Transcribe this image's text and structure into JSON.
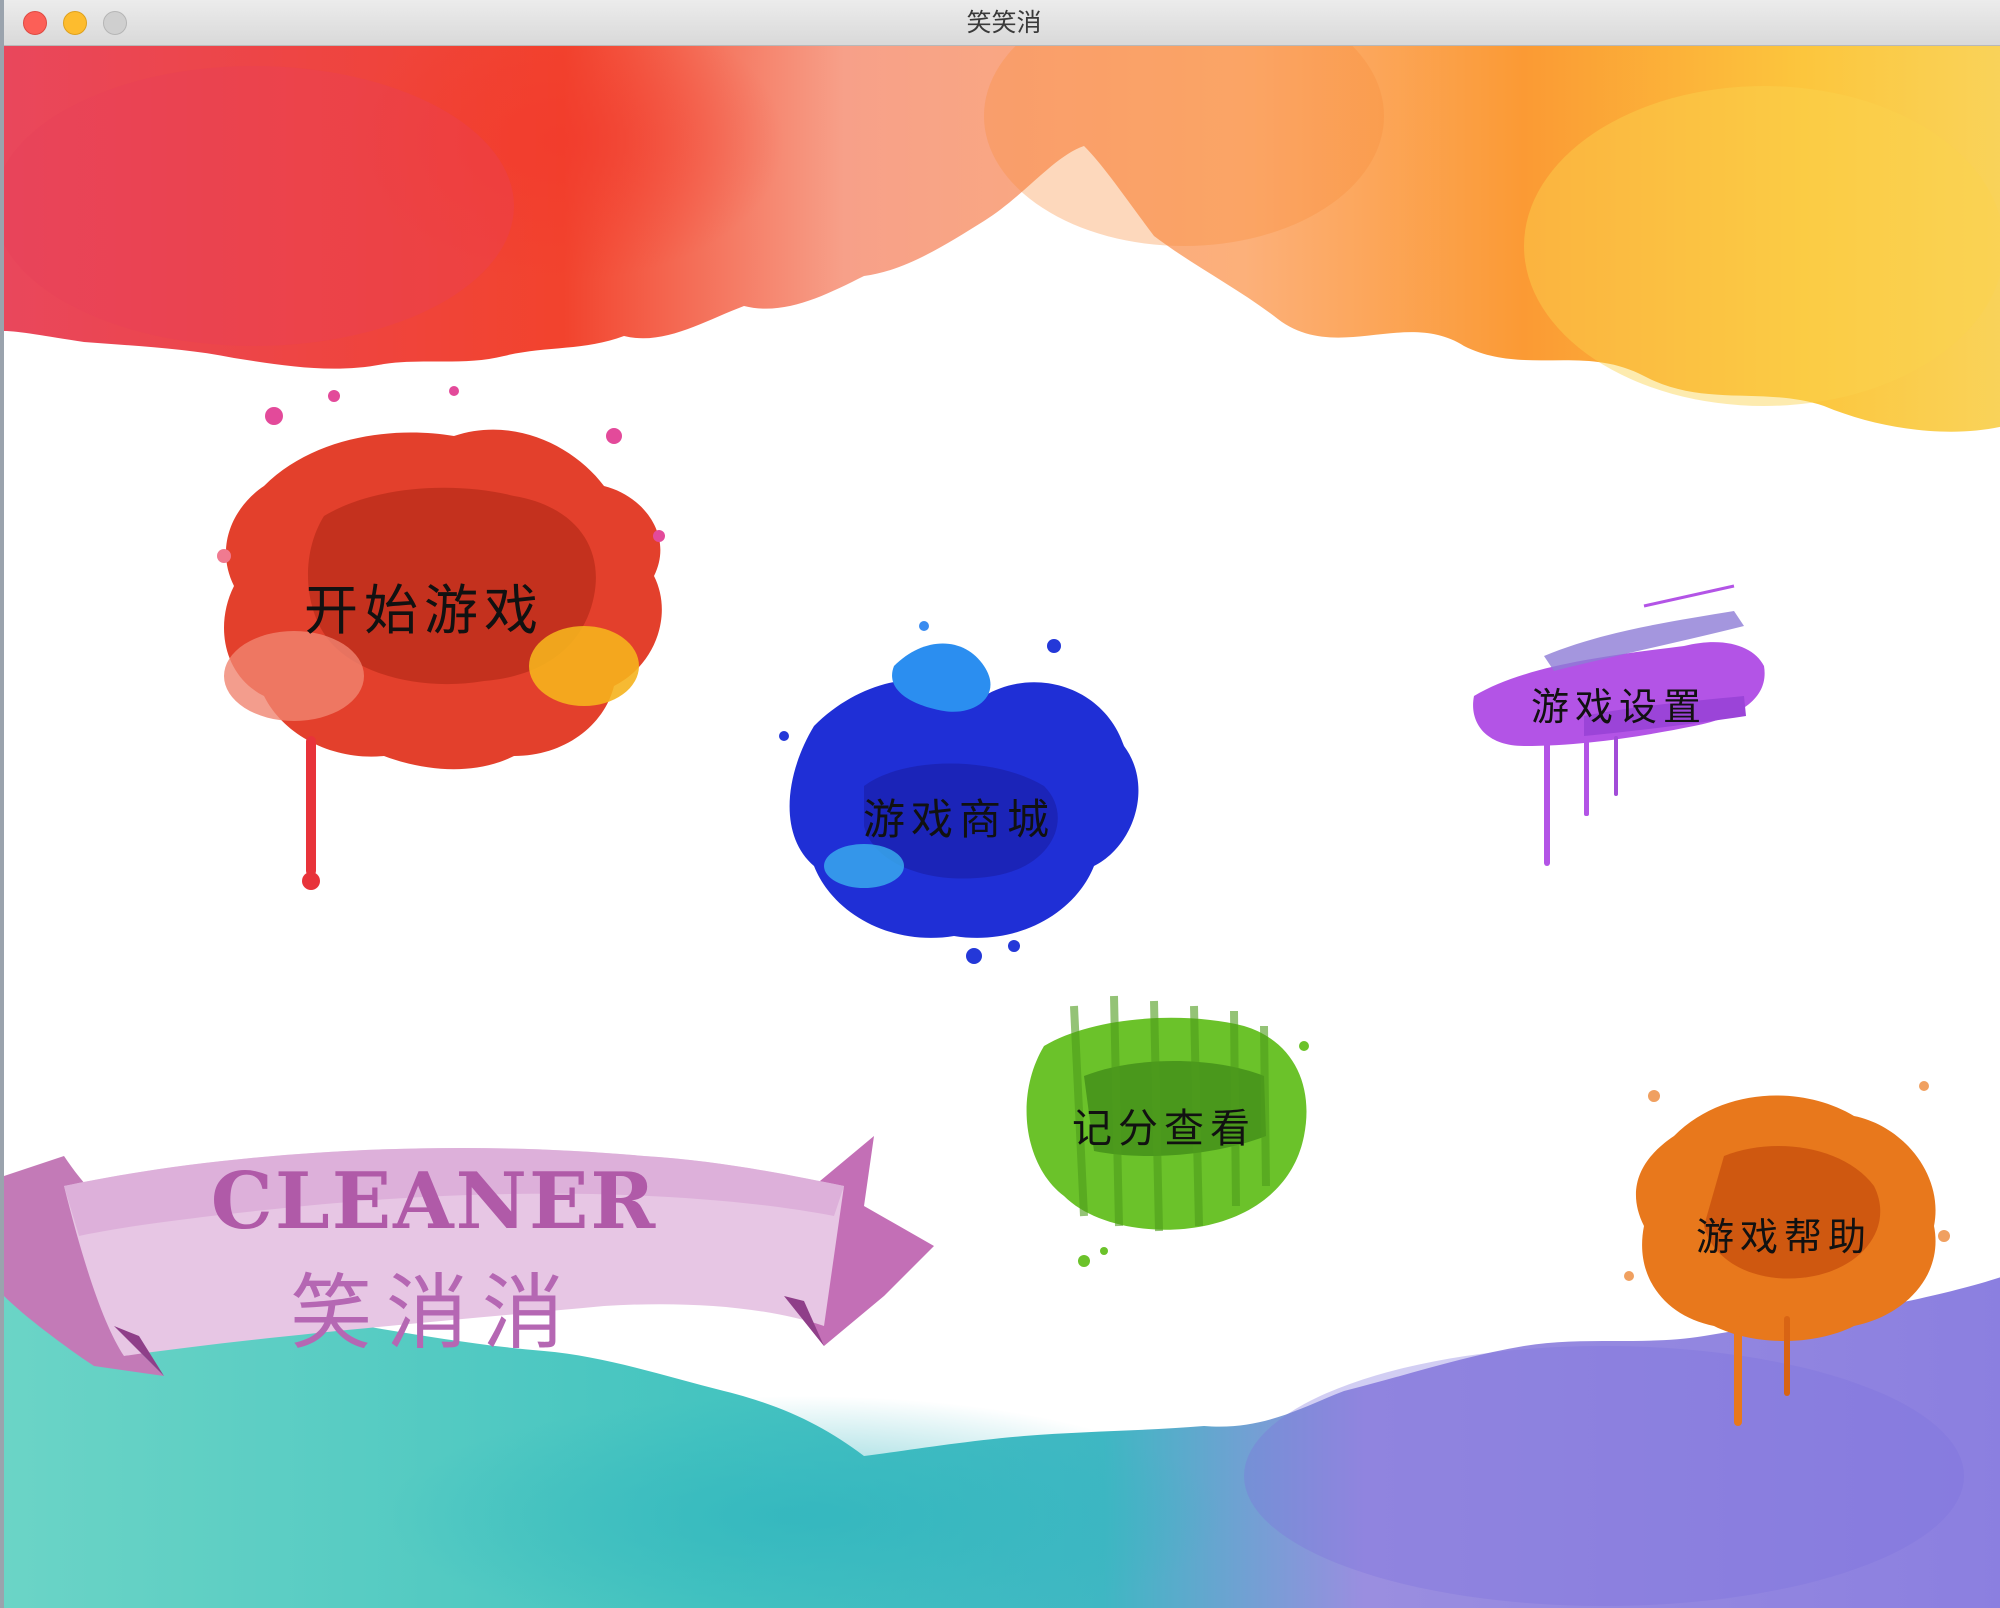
{
  "window": {
    "title": "笑笑消"
  },
  "menu": {
    "start": "开始游戏",
    "shop": "游戏商城",
    "settings": "游戏设置",
    "scores": "记分查看",
    "help": "游戏帮助"
  },
  "logo": {
    "english": "CLEANER",
    "chinese": "笑消消"
  },
  "colors": {
    "start_splat": "#d8321e",
    "shop_splat": "#1f2fd6",
    "settings_splat": "#a74ee0",
    "scores_splat": "#5aaa22",
    "help_splat": "#e36a12",
    "ribbon": "#d58cc9"
  },
  "icons": {
    "close": "close-traffic-light",
    "minimize": "minimize-traffic-light",
    "maximize": "maximize-traffic-light"
  }
}
